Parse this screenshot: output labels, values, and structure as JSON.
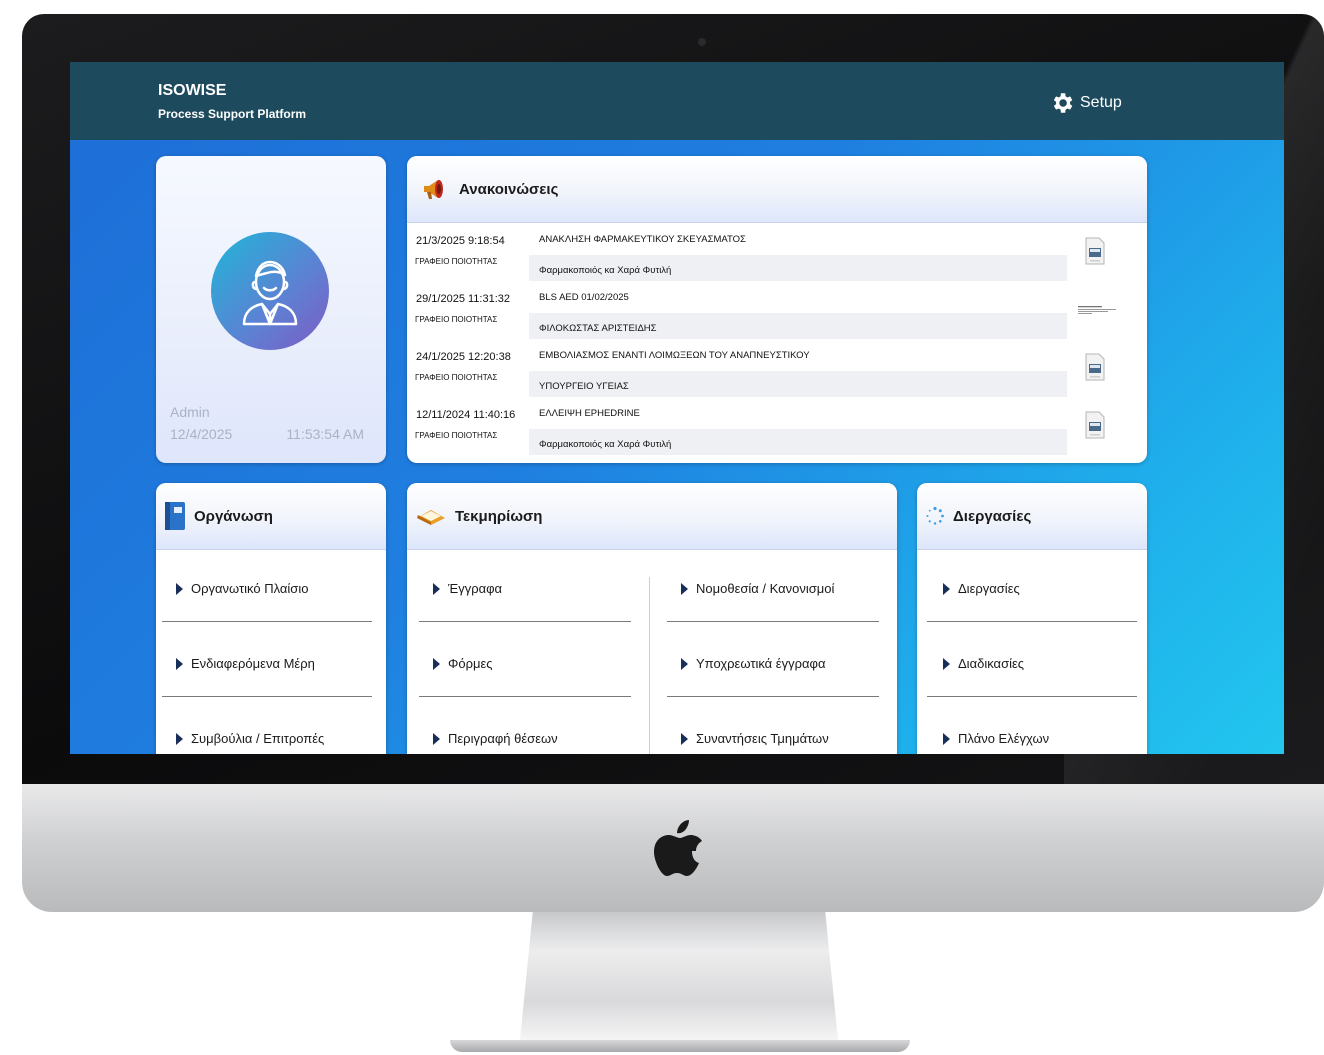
{
  "header": {
    "brand": "ISOWISE",
    "subtitle": "Process Support Platform",
    "setup_label": "Setup"
  },
  "profile": {
    "user": "Admin",
    "date": "12/4/2025",
    "time": "11:53:54 AM"
  },
  "announcements": {
    "title": "Ανακοινώσεις",
    "items": [
      {
        "date": "21/3/2025 9:18:54",
        "office": "ΓΡΑΦΕΙΟ ΠΟΙΟΤΗΤΑΣ",
        "title": "ΑΝΑΚΛΗΣΗ ΦΑΡΜΑΚΕΥΤΙΚΟΥ ΣΚΕΥΑΣΜΑΤΟΣ",
        "author": "Φαρμακοποιός κα Χαρά Φυτιλή",
        "attachment": "pdf-icon"
      },
      {
        "date": "29/1/2025 11:31:32",
        "office": "ΓΡΑΦΕΙΟ ΠΟΙΟΤΗΤΑΣ",
        "title": "BLS AED 01/02/2025",
        "author": "ΦΙΛΟΚΩΣΤΑΣ ΑΡΙΣΤΕΙΔΗΣ",
        "attachment": "document-thumbnail"
      },
      {
        "date": "24/1/2025 12:20:38",
        "office": "ΓΡΑΦΕΙΟ ΠΟΙΟΤΗΤΑΣ",
        "title": "ΕΜΒΟΛΙΑΣΜΟΣ ΕΝΑΝΤΙ ΛΟΙΜΩΞΕΩΝ ΤΟΥ ΑΝΑΠΝΕΥΣΤΙΚΟΥ",
        "author": "ΥΠΟΥΡΓΕΙΟ ΥΓΕΙΑΣ",
        "attachment": "pdf-icon"
      },
      {
        "date": "12/11/2024 11:40:16",
        "office": "ΓΡΑΦΕΙΟ ΠΟΙΟΤΗΤΑΣ",
        "title": "ΕΛΛΕΙΨΗ EPHEDRINE",
        "author": "Φαρμακοποιός κα Χαρά Φυτιλή",
        "attachment": "pdf-icon"
      }
    ]
  },
  "organization": {
    "title": "Οργάνωση",
    "items": [
      "Οργανωτικό Πλαίσιο",
      "Ενδιαφερόμενα Μέρη",
      "Συμβούλια / Επιτροπές"
    ]
  },
  "documentation": {
    "title": "Τεκμηρίωση",
    "left_items": [
      "Έγγραφα",
      "Φόρμες",
      "Περιγραφή θέσεων"
    ],
    "right_items": [
      "Νομοθεσία / Κανονισμοί",
      "Υποχρεωτικά έγγραφα",
      "Συναντήσεις Τμημάτων"
    ]
  },
  "processes": {
    "title": "Διεργασίες",
    "items": [
      "Διεργασίες",
      "Διαδικασίες",
      "Πλάνο Ελέγχων"
    ]
  },
  "colors": {
    "header_bg": "#1d4a5c",
    "menu_arrow": "#1a2e5a",
    "background_start": "#1e6dd6",
    "background_end": "#22c6ee"
  }
}
